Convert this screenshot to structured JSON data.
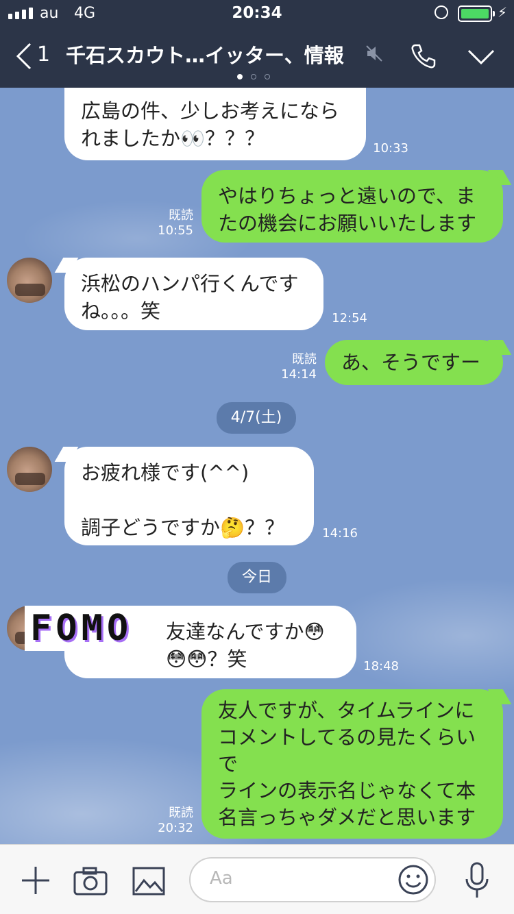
{
  "status": {
    "carrier": "au",
    "network": "4G",
    "time": "20:34"
  },
  "header": {
    "unread": "1",
    "title": "千石スカウト…イッター、情報"
  },
  "messages": [
    {
      "dir": "in",
      "text": "広島の件、少しお考えになら\nれましたか👀？？？",
      "time": "10:33"
    },
    {
      "dir": "out",
      "text": "やはりちょっと遠いので、ま\nたの機会にお願いいたします",
      "read": "既読",
      "time": "10:55"
    },
    {
      "dir": "in",
      "text": "浜松のハンパ行くんです\nね。。。笑",
      "time": "12:54"
    },
    {
      "dir": "out",
      "text": "あ、そうですー",
      "read": "既読",
      "time": "14:14"
    },
    {
      "dir": "in",
      "text": "お疲れ様です(^^)\n\n調子どうですか🤔？？",
      "time": "14:16"
    },
    {
      "dir": "in",
      "text": "友達なんですか😳\n😳😳？笑",
      "time": "18:48"
    },
    {
      "dir": "out",
      "text": "友人ですが、タイムラインに\nコメントしてるの見たくらい\nで\nラインの表示名じゃなくて本\n名言っちゃダメだと思います",
      "read": "既読",
      "time": "20:32"
    }
  ],
  "dates": {
    "date1": "4/7(土)",
    "date2": "今日"
  },
  "sticker": {
    "text": "FOMO"
  },
  "input": {
    "placeholder": "Aa"
  },
  "colors": {
    "header_bg": "#2c3548",
    "chat_bg": "#7c9bcd",
    "out_bubble": "#84e04f",
    "in_bubble": "#ffffff",
    "date_pill": "#5c7bab"
  },
  "icons": [
    "back-chevron-icon",
    "mute-icon",
    "phone-icon",
    "chevron-down-icon",
    "plus-icon",
    "camera-icon",
    "image-icon",
    "emoji-icon",
    "microphone-icon"
  ]
}
